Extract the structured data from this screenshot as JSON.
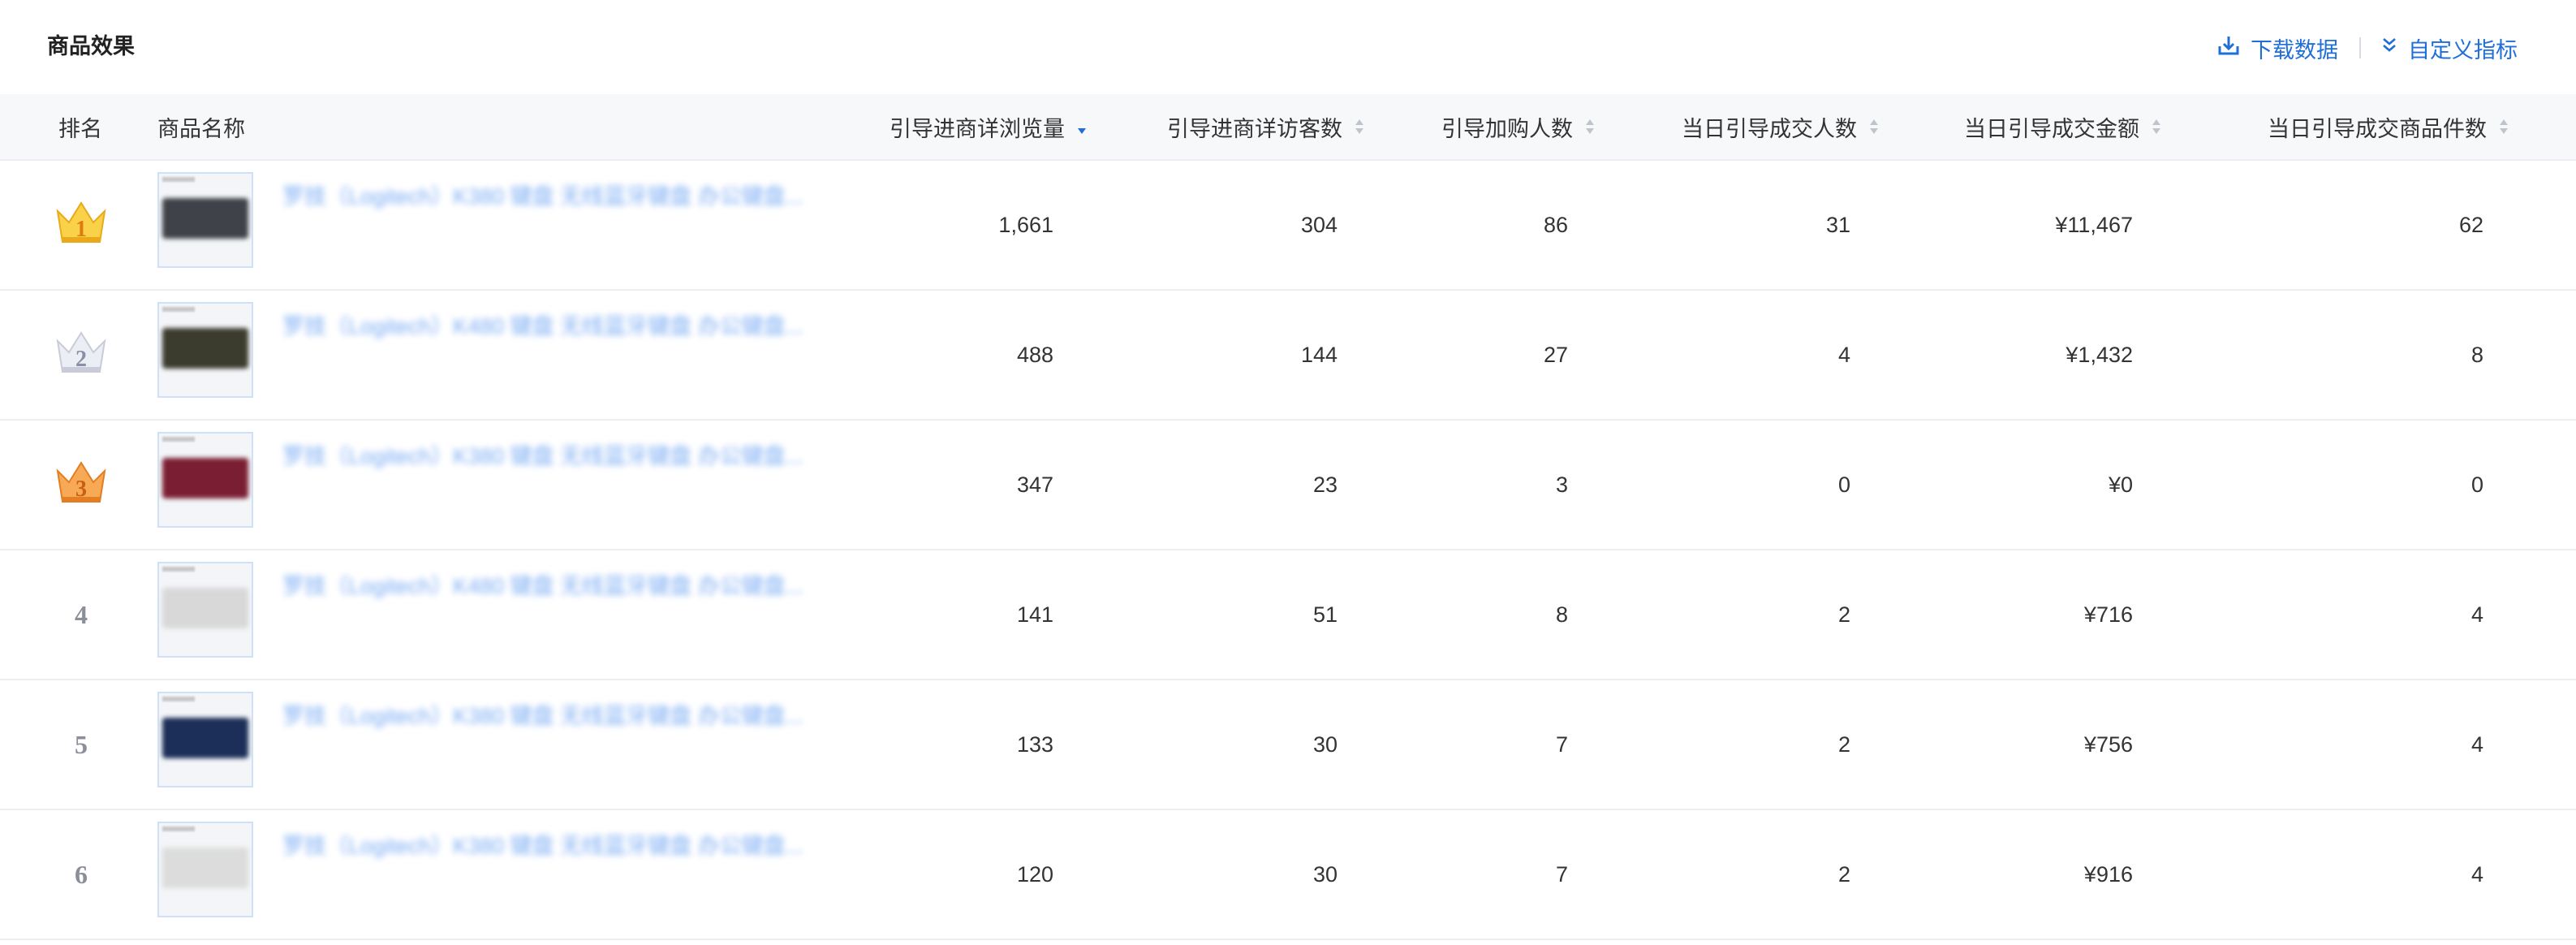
{
  "page": {
    "title": "商品效果"
  },
  "actions": {
    "download_label": "下载数据",
    "custom_label": "自定义指标"
  },
  "columns": {
    "rank": "排名",
    "name": "商品名称",
    "views": "引导进商详浏览量",
    "visitors": "引导进商详访客数",
    "cart": "引导加购人数",
    "buyers": "当日引导成交人数",
    "amount": "当日引导成交金额",
    "items": "当日引导成交商品件数"
  },
  "sort": {
    "active_column": "views",
    "direction": "desc",
    "active_color": "#1f6fd6",
    "inactive_color": "#c0c4cc"
  },
  "rows": [
    {
      "rank": "1",
      "name": "罗技（Logitech）K380 键盘 无线蓝牙键盘 办公键盘...",
      "views": "1,661",
      "visitors": "304",
      "cart": "86",
      "buyers": "31",
      "amount": "¥11,467",
      "items": "62",
      "medal": "gold",
      "kb_color": "#3f4349"
    },
    {
      "rank": "2",
      "name": "罗技（Logitech）K480 键盘 无线蓝牙键盘 办公键盘...",
      "views": "488",
      "visitors": "144",
      "cart": "27",
      "buyers": "4",
      "amount": "¥1,432",
      "items": "8",
      "medal": "silver",
      "kb_color": "#3b3b2e"
    },
    {
      "rank": "3",
      "name": "罗技（Logitech）K380 键盘 无线蓝牙键盘 办公键盘...",
      "views": "347",
      "visitors": "23",
      "cart": "3",
      "buyers": "0",
      "amount": "¥0",
      "items": "0",
      "medal": "bronze",
      "kb_color": "#7a1f33"
    },
    {
      "rank": "4",
      "name": "罗技（Logitech）K480 键盘 无线蓝牙键盘 办公键盘...",
      "views": "141",
      "visitors": "51",
      "cart": "8",
      "buyers": "2",
      "amount": "¥716",
      "items": "4",
      "medal": "",
      "kb_color": "#d8d8d8"
    },
    {
      "rank": "5",
      "name": "罗技（Logitech）K380 键盘 无线蓝牙键盘 办公键盘...",
      "views": "133",
      "visitors": "30",
      "cart": "7",
      "buyers": "2",
      "amount": "¥756",
      "items": "4",
      "medal": "",
      "kb_color": "#1c2f58"
    },
    {
      "rank": "6",
      "name": "罗技（Logitech）K380 键盘 无线蓝牙键盘 办公键盘...",
      "views": "120",
      "visitors": "30",
      "cart": "7",
      "buyers": "2",
      "amount": "¥916",
      "items": "4",
      "medal": "",
      "kb_color": "#dcdcdc"
    }
  ],
  "icons": {
    "download": "download-icon",
    "custom": "double-chevron-down-icon",
    "medal": "crown-medal-icon",
    "sort": "sort-caret-icon"
  },
  "colors": {
    "link": "#1f6fd6",
    "gold": "#f7c63a",
    "silver": "#e4e6ef",
    "bronze": "#f5a04a"
  }
}
